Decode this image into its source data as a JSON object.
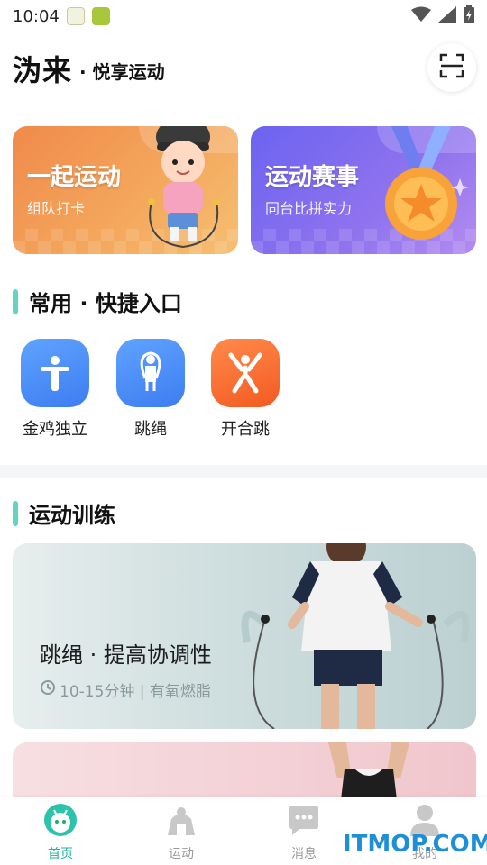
{
  "status_bar": {
    "time": "10:04"
  },
  "header": {
    "brand": "沩来",
    "slogan": "· 悦享运动"
  },
  "feature_cards": [
    {
      "title": "一起运动",
      "subtitle": "组队打卡"
    },
    {
      "title": "运动赛事",
      "subtitle": "同台比拼实力"
    }
  ],
  "shortcuts": {
    "title": "常用 · 快捷入口",
    "items": [
      {
        "label": "金鸡独立"
      },
      {
        "label": "跳绳"
      },
      {
        "label": "开合跳"
      }
    ]
  },
  "training": {
    "title": "运动训练",
    "cards": [
      {
        "title": "跳绳 · 提高协调性",
        "meta": "10-15分钟 | 有氧燃脂"
      }
    ]
  },
  "tab_bar": {
    "items": [
      {
        "label": "首页",
        "active": true
      },
      {
        "label": "运动"
      },
      {
        "label": "消息"
      },
      {
        "label": "我的"
      }
    ]
  },
  "watermark": "ITMOP.COM",
  "colors": {
    "accent": "#5fd6c2",
    "tab_active": "#1db3a0",
    "orange": "#f08a4b",
    "purple": "#7b6bf0"
  }
}
